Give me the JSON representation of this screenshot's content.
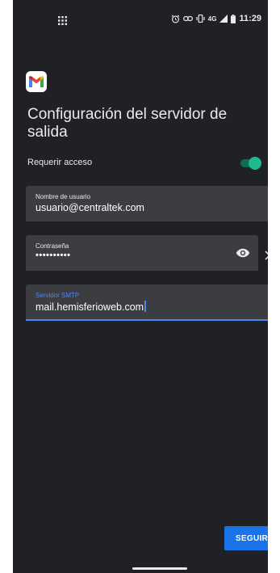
{
  "status_bar": {
    "network": "4G",
    "time": "11:29",
    "icons": [
      "app-grid-icon",
      "alarm-icon",
      "link-icon",
      "vibrate-icon",
      "signal-icon",
      "battery-icon"
    ]
  },
  "header": {
    "logo": "gmail-logo",
    "title": "Configuración del servidor de salida"
  },
  "require_login": {
    "label": "Requerir acceso",
    "enabled": true
  },
  "fields": {
    "username": {
      "label": "Nombre de usuario",
      "value": "usuario@centraltek.com"
    },
    "password": {
      "label": "Contraseña",
      "value": "••••••••••"
    },
    "smtp": {
      "label": "Servidor SMTP",
      "value": "mail.hemisferioweb.com"
    }
  },
  "actions": {
    "next_label": "SEGUIR"
  },
  "colors": {
    "background": "#202124",
    "field": "#3c3d40",
    "accent": "#4b86f0",
    "button": "#1a73e8",
    "switch_on": "#1eb98f"
  }
}
